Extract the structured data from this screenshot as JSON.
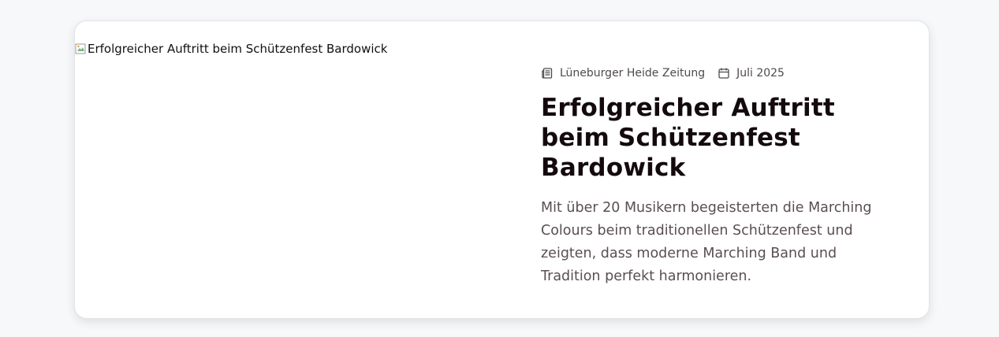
{
  "article": {
    "image_alt": "Erfolgreicher Auftritt beim Schützenfest Bardowick",
    "source": "Lüneburger Heide Zeitung",
    "source_icon": "newspaper-icon",
    "date": "Juli 2025",
    "date_icon": "calendar-icon",
    "title": "Erfolgreicher Auftritt beim Schützenfest Bardowick",
    "description": "Mit über 20 Musikern begeisterten die Marching Colours beim traditionellen Schützenfest und zeigten, dass moderne Marching Band und Tradition perfekt harmonieren."
  }
}
